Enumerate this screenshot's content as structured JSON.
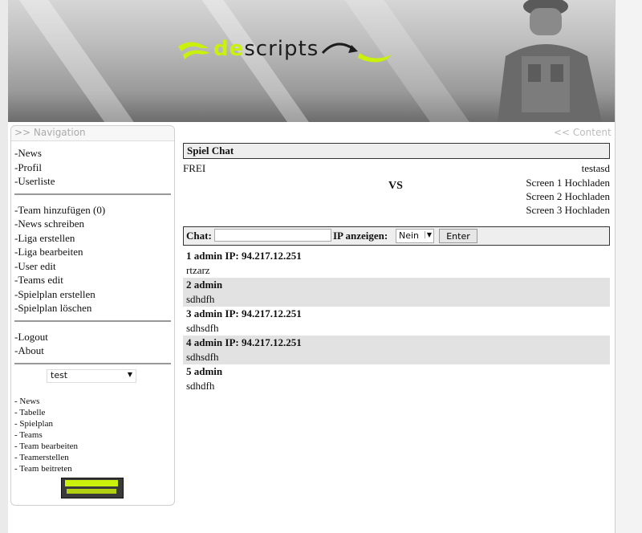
{
  "header": {
    "logo_de": "de",
    "logo_scripts": "scripts"
  },
  "sidebar": {
    "title": ">> Navigation",
    "group1": [
      "-News",
      "-Profil",
      "-Userliste"
    ],
    "group2": [
      "-Team hinzufügen (0)",
      "-News schreiben",
      "-Liga erstellen",
      "-Liga bearbeiten",
      "-User edit",
      "-Teams edit",
      "-Spielplan erstellen",
      "-Spielplan löschen"
    ],
    "group3": [
      "-Logout",
      "-About"
    ],
    "select_value": "test",
    "sub_links": [
      "- News",
      "- Tabelle",
      "- Spielplan",
      "- Teams",
      "- Team bearbeiten",
      "- Teamerstellen",
      "- Team beitreten"
    ]
  },
  "content": {
    "title": "<< Content",
    "section_title": "Spiel Chat",
    "team1": "FREI",
    "team2": "testasd",
    "vs": "VS",
    "screens": [
      "Screen 1 Hochladen",
      "Screen 2 Hochladen",
      "Screen 3 Hochladen"
    ],
    "chat_label": "Chat:",
    "ip_label": "IP anzeigen:",
    "ip_select": "Nein",
    "enter_button": "Enter",
    "messages": [
      {
        "head": "1 admin IP: 94.217.12.251",
        "text": "rtzarz"
      },
      {
        "head": "2 admin",
        "text": "sdhdfh"
      },
      {
        "head": "3 admin IP: 94.217.12.251",
        "text": "sdhsdfh"
      },
      {
        "head": "4 admin IP: 94.217.12.251",
        "text": "sdhsdfh"
      },
      {
        "head": "5 admin",
        "text": "sdhdfh"
      }
    ]
  },
  "colors": {
    "accent": "#c9f10b",
    "alt_row": "#e2e2e2"
  }
}
